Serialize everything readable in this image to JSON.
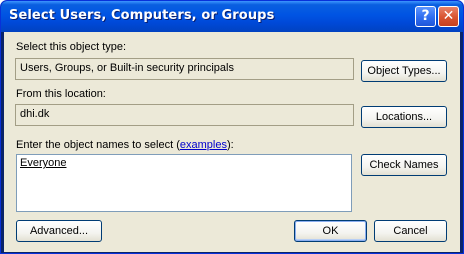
{
  "window": {
    "title": "Select Users, Computers, or Groups"
  },
  "controls": {
    "help_glyph": "?",
    "close_glyph": "✕"
  },
  "object_type": {
    "label": "Select this object type:",
    "value": "Users, Groups, or Built-in security principals",
    "button": "Object Types..."
  },
  "location": {
    "label": "From this location:",
    "value": "dhi.dk",
    "button": "Locations..."
  },
  "names": {
    "label_prefix": "Enter the object names to select (",
    "label_link": "examples",
    "label_suffix": "):",
    "entry": "Everyone",
    "button": "Check Names"
  },
  "footer": {
    "advanced": "Advanced...",
    "ok": "OK",
    "cancel": "Cancel"
  }
}
